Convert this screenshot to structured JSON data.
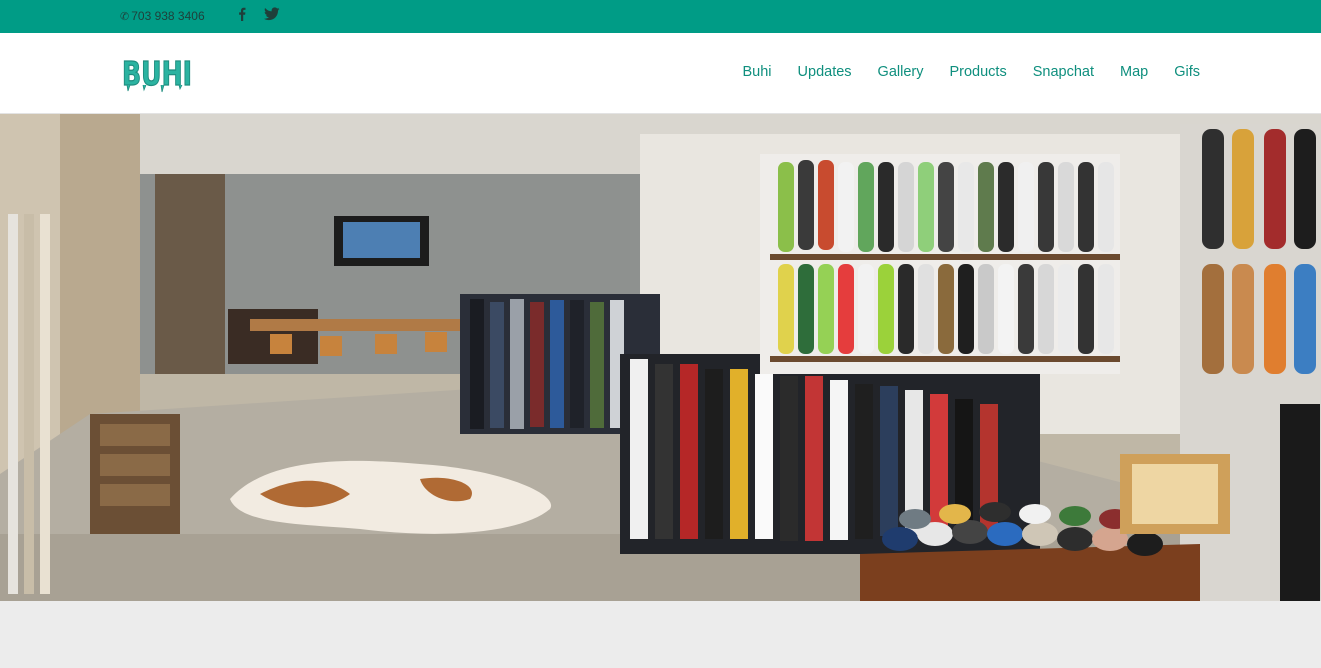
{
  "topbar": {
    "phone": "703 938 3406",
    "phone_icon": "phone-icon",
    "social": [
      "facebook-icon",
      "twitter-icon"
    ],
    "bg_color": "#009c86"
  },
  "header": {
    "logo_text": "BUHI",
    "logo_color": "#2bb3a1",
    "nav": [
      {
        "label": "Buhi"
      },
      {
        "label": "Updates"
      },
      {
        "label": "Gallery"
      },
      {
        "label": "Products"
      },
      {
        "label": "Snapchat"
      },
      {
        "label": "Map"
      },
      {
        "label": "Gifs"
      }
    ],
    "nav_color": "#0f8f7e"
  }
}
